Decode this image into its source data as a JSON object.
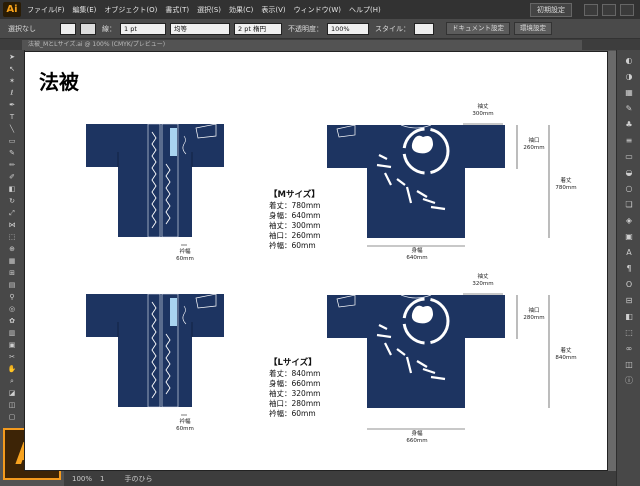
{
  "app": {
    "logo": "Ai",
    "big_logo": "Ai"
  },
  "menu": [
    "ファイル(F)",
    "編集(E)",
    "オブジェクト(O)",
    "書式(T)",
    "選択(S)",
    "効果(C)",
    "表示(V)",
    "ウィンドウ(W)",
    "ヘルプ(H)"
  ],
  "workspace": {
    "label": "初期設定"
  },
  "control_bar": {
    "selection": "選択なし",
    "stroke_label": "線：",
    "stroke_weight": "1 pt",
    "stroke_style": "均等",
    "brush": "2 pt 楕円",
    "opacity_label": "不透明度：",
    "opacity": "100%",
    "style_label": "スタイル：",
    "doc_settings": "ドキュメント設定",
    "env_settings": "環境設定"
  },
  "doc_tab": {
    "label": "法被_MとLサイズ.ai @ 100% (CMYK/プレビュー)"
  },
  "status": {
    "zoom": "100%",
    "page": "1",
    "tool": "手のひら"
  },
  "artboard": {
    "title": "法被",
    "colors": {
      "happi": "#1d3461",
      "accent": "#a9d4f0",
      "white": "#ffffff"
    },
    "m": {
      "heading": "【Mサイズ】",
      "lines": [
        "着丈：780mm",
        "身幅：640mm",
        "袖丈：300mm",
        "袖口：260mm",
        "衿幅：60mm"
      ],
      "dims": {
        "eri": [
          "衿幅",
          "60mm"
        ],
        "sode": [
          "袖丈",
          "300mm"
        ],
        "sodeguchi": [
          "袖口",
          "260mm"
        ],
        "kitake": [
          "着丈",
          "780mm"
        ],
        "mihaba": [
          "身幅",
          "640mm"
        ]
      }
    },
    "l": {
      "heading": "【Lサイズ】",
      "lines": [
        "着丈：840mm",
        "身幅：660mm",
        "袖丈：320mm",
        "袖口：280mm",
        "衿幅：60mm"
      ],
      "dims": {
        "eri": [
          "衿幅",
          "60mm"
        ],
        "sode": [
          "袖丈",
          "320mm"
        ],
        "sodeguchi": [
          "袖口",
          "280mm"
        ],
        "kitake": [
          "着丈",
          "840mm"
        ],
        "mihaba": [
          "身幅",
          "660mm"
        ]
      }
    }
  }
}
